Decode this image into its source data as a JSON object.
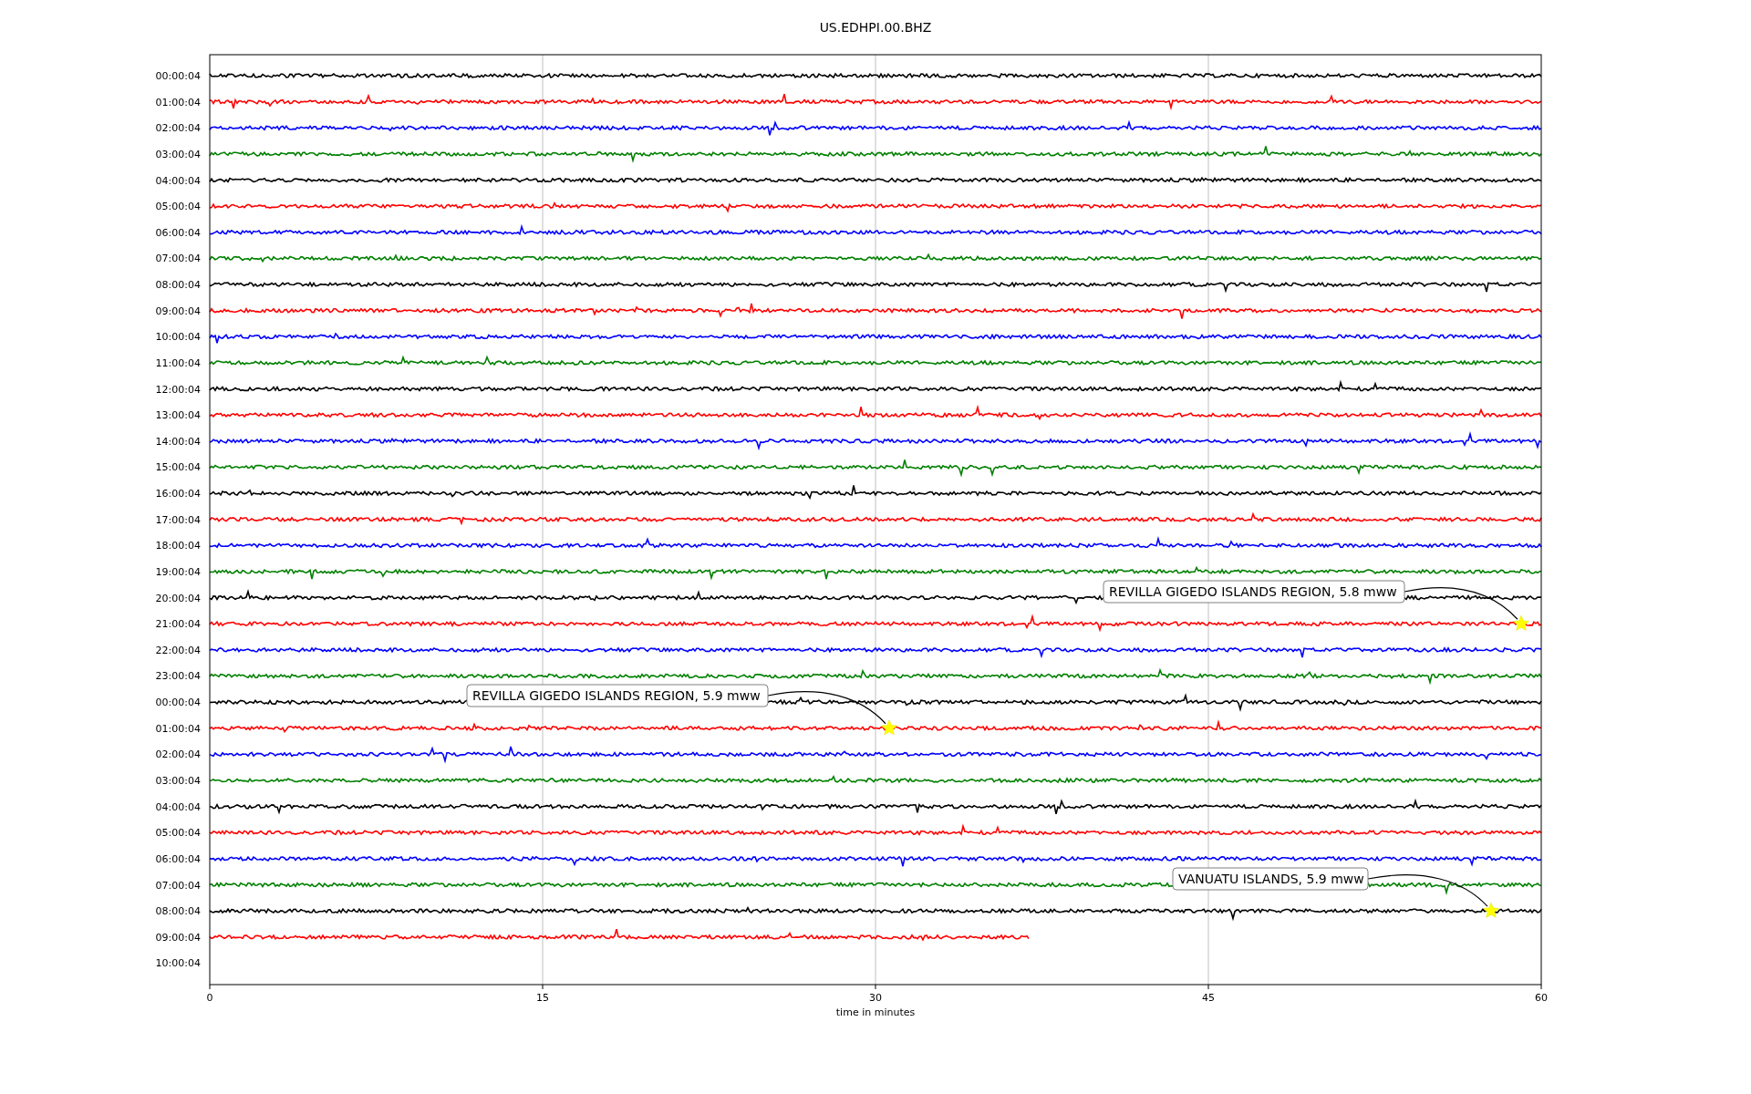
{
  "title": "US.EDHPI.00.BHZ",
  "traces": [
    {
      "label": "00:00:04",
      "color": "#000000"
    },
    {
      "label": "01:00:04",
      "color": "#ff0000"
    },
    {
      "label": "02:00:04",
      "color": "#0000ff"
    },
    {
      "label": "03:00:04",
      "color": "#008000"
    },
    {
      "label": "04:00:04",
      "color": "#000000"
    },
    {
      "label": "05:00:04",
      "color": "#ff0000"
    },
    {
      "label": "06:00:04",
      "color": "#0000ff"
    },
    {
      "label": "07:00:04",
      "color": "#008000"
    },
    {
      "label": "08:00:04",
      "color": "#000000"
    },
    {
      "label": "09:00:04",
      "color": "#ff0000"
    },
    {
      "label": "10:00:04",
      "color": "#0000ff"
    },
    {
      "label": "11:00:04",
      "color": "#008000"
    },
    {
      "label": "12:00:04",
      "color": "#000000"
    },
    {
      "label": "13:00:04",
      "color": "#ff0000"
    },
    {
      "label": "14:00:04",
      "color": "#0000ff"
    },
    {
      "label": "15:00:04",
      "color": "#008000"
    },
    {
      "label": "16:00:04",
      "color": "#000000"
    },
    {
      "label": "17:00:04",
      "color": "#ff0000"
    },
    {
      "label": "18:00:04",
      "color": "#0000ff"
    },
    {
      "label": "19:00:04",
      "color": "#008000"
    },
    {
      "label": "20:00:04",
      "color": "#000000"
    },
    {
      "label": "21:00:04",
      "color": "#ff0000",
      "event": "REVILLA GIGEDO ISLANDS REGION, 5.8 mww"
    },
    {
      "label": "22:00:04",
      "color": "#0000ff"
    },
    {
      "label": "23:00:04",
      "color": "#008000"
    },
    {
      "label": "00:00:04",
      "color": "#000000"
    },
    {
      "label": "01:00:04",
      "color": "#ff0000",
      "event": "REVILLA GIGEDO ISLANDS REGION, 5.9 mww"
    },
    {
      "label": "02:00:04",
      "color": "#0000ff"
    },
    {
      "label": "03:00:04",
      "color": "#008000"
    },
    {
      "label": "04:00:04",
      "color": "#000000"
    },
    {
      "label": "05:00:04",
      "color": "#ff0000"
    },
    {
      "label": "06:00:04",
      "color": "#0000ff"
    },
    {
      "label": "07:00:04",
      "color": "#008000"
    },
    {
      "label": "08:00:04",
      "color": "#000000",
      "event": "VANUATU ISLANDS, 5.9 mww"
    },
    {
      "label": "09:00:04",
      "color": "#ff0000"
    },
    {
      "label": "10:00:04"
    }
  ],
  "xticks": [
    "0",
    "15",
    "30",
    "45",
    "60"
  ],
  "xlabel": "time in minutes"
}
